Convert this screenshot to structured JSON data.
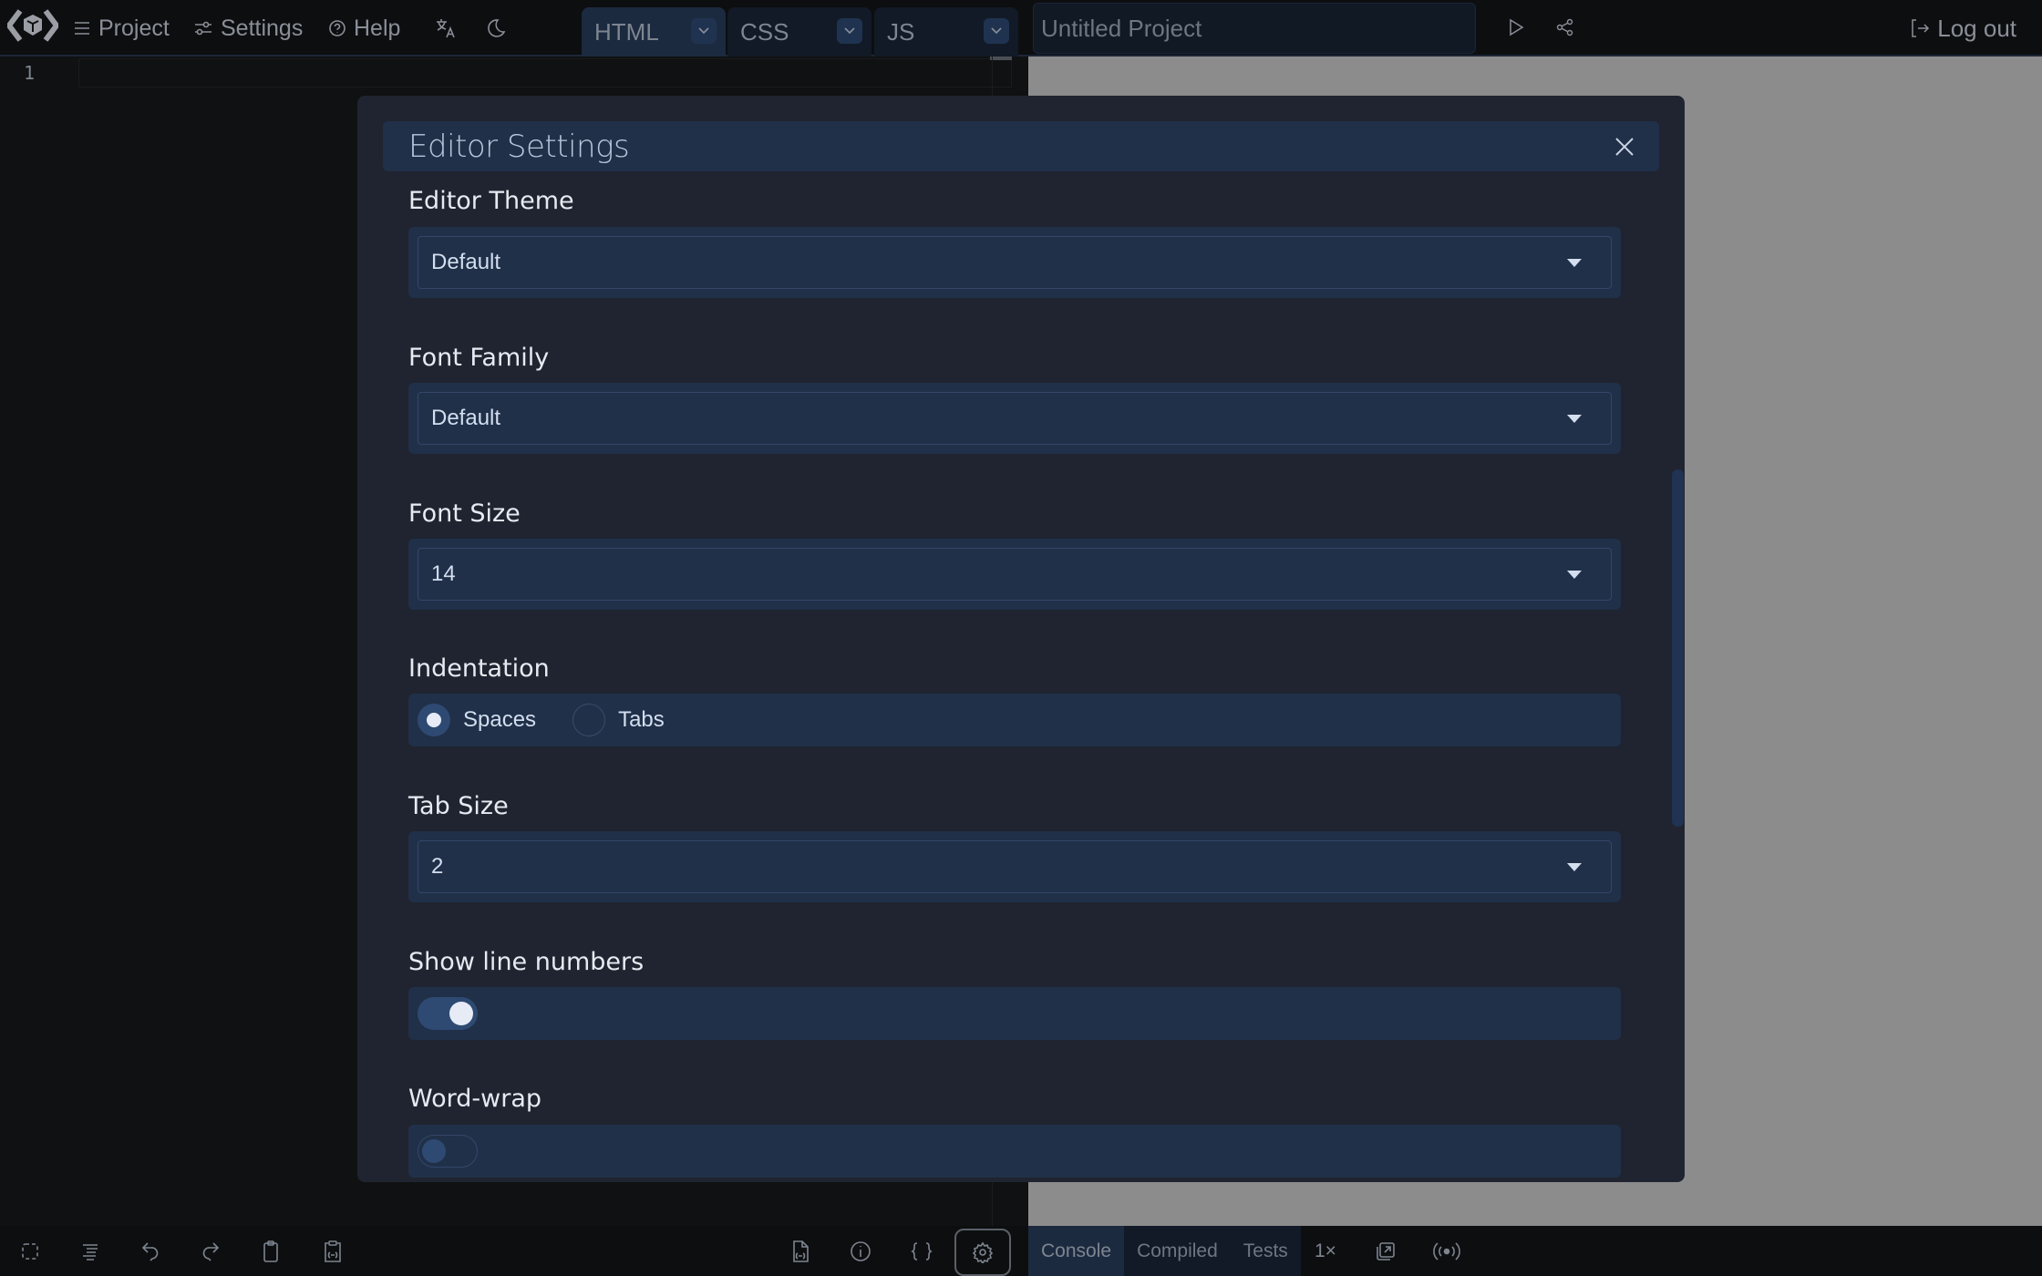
{
  "topbar": {
    "logo": "app-logo",
    "menu": [
      {
        "label": "Project",
        "icon": "hamburger-icon"
      },
      {
        "label": "Settings",
        "icon": "sliders-icon"
      },
      {
        "label": "Help",
        "icon": "help-circle-icon"
      }
    ],
    "language_icon": "translate-icon",
    "theme_icon": "moon-icon",
    "editor_tabs": [
      {
        "label": "HTML",
        "active": true
      },
      {
        "label": "CSS",
        "active": false
      },
      {
        "label": "JS",
        "active": false
      }
    ],
    "project_title": {
      "value": "",
      "placeholder": "Untitled Project"
    },
    "run_icon": "play-icon",
    "share_icon": "share-icon",
    "logout_label": "Log out"
  },
  "editor": {
    "line_numbers": [
      "1"
    ]
  },
  "modal": {
    "title": "Editor Settings",
    "fields": {
      "editor_theme": {
        "label": "Editor Theme",
        "value": "Default"
      },
      "font_family": {
        "label": "Font Family",
        "value": "Default"
      },
      "font_size": {
        "label": "Font Size",
        "value": "14"
      },
      "indentation": {
        "label": "Indentation",
        "options": [
          "Spaces",
          "Tabs"
        ],
        "selected": "Spaces"
      },
      "tab_size": {
        "label": "Tab Size",
        "value": "2"
      },
      "show_line_numbers": {
        "label": "Show line numbers",
        "enabled": true
      },
      "word_wrap": {
        "label": "Word-wrap",
        "enabled": false
      }
    }
  },
  "bottombar": {
    "editor_tools": [
      "select-all-icon",
      "format-icon",
      "undo-icon",
      "redo-icon",
      "copy-icon",
      "copy-as-url-icon"
    ],
    "right_tools": [
      "share-file-icon",
      "info-icon",
      "braces-icon",
      "gear-icon"
    ],
    "console_tabs": [
      {
        "label": "Console",
        "active": true
      },
      {
        "label": "Compiled",
        "active": false
      },
      {
        "label": "Tests",
        "active": false
      }
    ],
    "speed_label": "1×",
    "preview_tools": [
      "open-external-icon",
      "broadcast-icon"
    ]
  }
}
